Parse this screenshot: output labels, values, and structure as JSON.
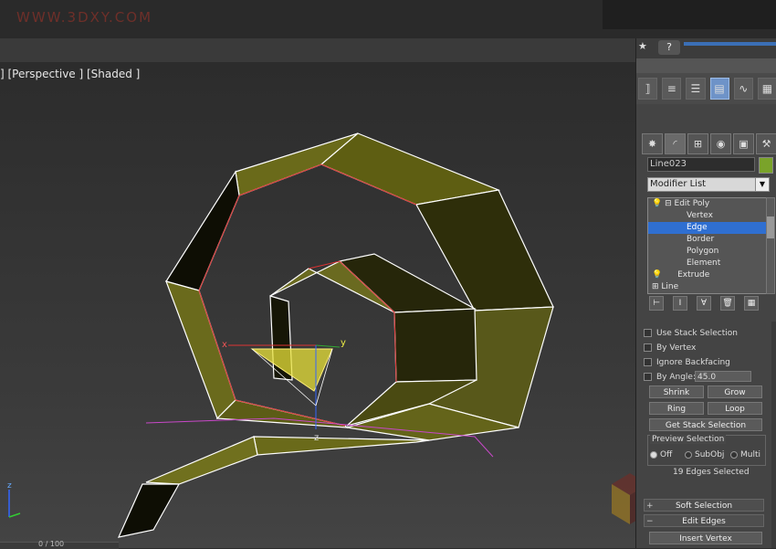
{
  "watermark": "WWW.3DXY.COM",
  "viewport": {
    "label": "] [Perspective ] [Shaded ]"
  },
  "gizmo": {
    "x": "x",
    "y": "y",
    "z": "z",
    "corner_z": "z"
  },
  "status": {
    "frame": "0 / 100"
  },
  "top": {
    "help": "?",
    "star": "★"
  },
  "toolbar_icons": [
    "align-icon",
    "normal-align-icon",
    "layer-icon",
    "scene-explorer-icon",
    "curve-editor-icon",
    "render-icon"
  ],
  "command_tabs": [
    "create-tab",
    "modify-tab",
    "hierarchy-tab",
    "motion-tab",
    "display-tab",
    "utilities-tab"
  ],
  "object": {
    "name": "Line023",
    "color": "#7aa32a"
  },
  "modifier_list": {
    "label": "Modifier List"
  },
  "stack": {
    "items": [
      {
        "label": "Edit Poly",
        "level": 0,
        "selected": false
      },
      {
        "label": "Vertex",
        "level": 1,
        "selected": false
      },
      {
        "label": "Edge",
        "level": 1,
        "selected": true
      },
      {
        "label": "Border",
        "level": 1,
        "selected": false
      },
      {
        "label": "Polygon",
        "level": 1,
        "selected": false
      },
      {
        "label": "Element",
        "level": 1,
        "selected": false
      },
      {
        "label": "Extrude",
        "level": 0,
        "selected": false
      },
      {
        "label": "Line",
        "level": 0,
        "selected": false
      }
    ]
  },
  "selection": {
    "use_stack": "Use Stack Selection",
    "by_vertex": "By Vertex",
    "ignore_backfacing": "Ignore Backfacing",
    "by_angle": "By Angle:",
    "angle_value": "45.0",
    "shrink": "Shrink",
    "grow": "Grow",
    "ring": "Ring",
    "loop": "Loop",
    "get_stack": "Get Stack Selection",
    "preview_title": "Preview Selection",
    "preview_off": "Off",
    "preview_subobj": "SubObj",
    "preview_multi": "Multi",
    "count": "19 Edges Selected"
  },
  "rollouts": {
    "soft_selection": "Soft Selection",
    "edit_edges": "Edit Edges",
    "insert_vertex": "Insert Vertex"
  },
  "colors": {
    "accent": "#2f6fd1",
    "mesh": "#5a5a14",
    "wire": "#ffffff"
  }
}
